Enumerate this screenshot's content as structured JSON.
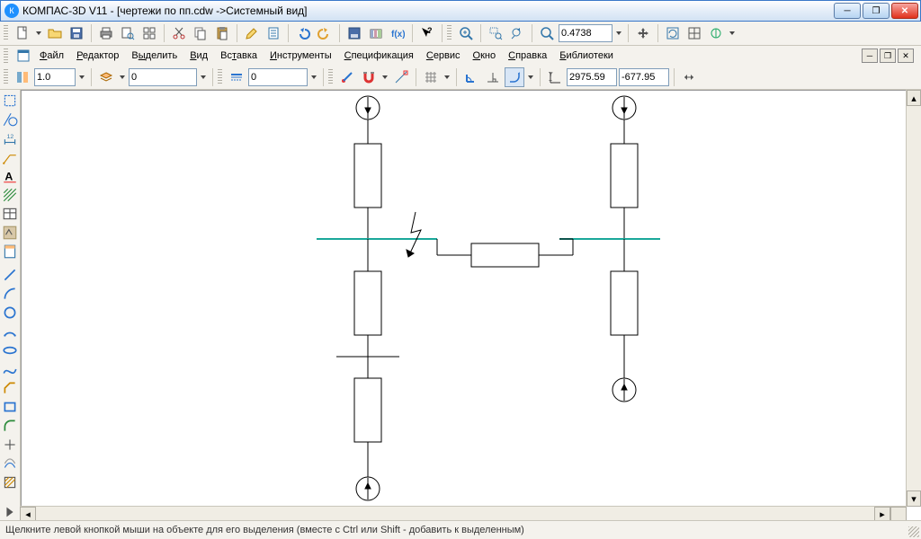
{
  "title": "КОМПАС-3D V11 - [чертежи по пп.cdw ->Системный вид]",
  "zoom_value": "0.4738",
  "menus": [
    "Файл",
    "Редактор",
    "Выделить",
    "Вид",
    "Вставка",
    "Инструменты",
    "Спецификация",
    "Сервис",
    "Окно",
    "Справка",
    "Библиотеки"
  ],
  "menu_underline_idx": [
    0,
    0,
    1,
    0,
    2,
    0,
    0,
    0,
    0,
    0,
    0
  ],
  "scale_value": "1.0",
  "layer_value": "0",
  "style_value": "0",
  "coord_x": "2975.59",
  "coord_y": "-677.95",
  "status": "Щелкните левой кнопкой мыши на объекте для его выделения (вместе с Ctrl или Shift - добавить к выделенным)"
}
